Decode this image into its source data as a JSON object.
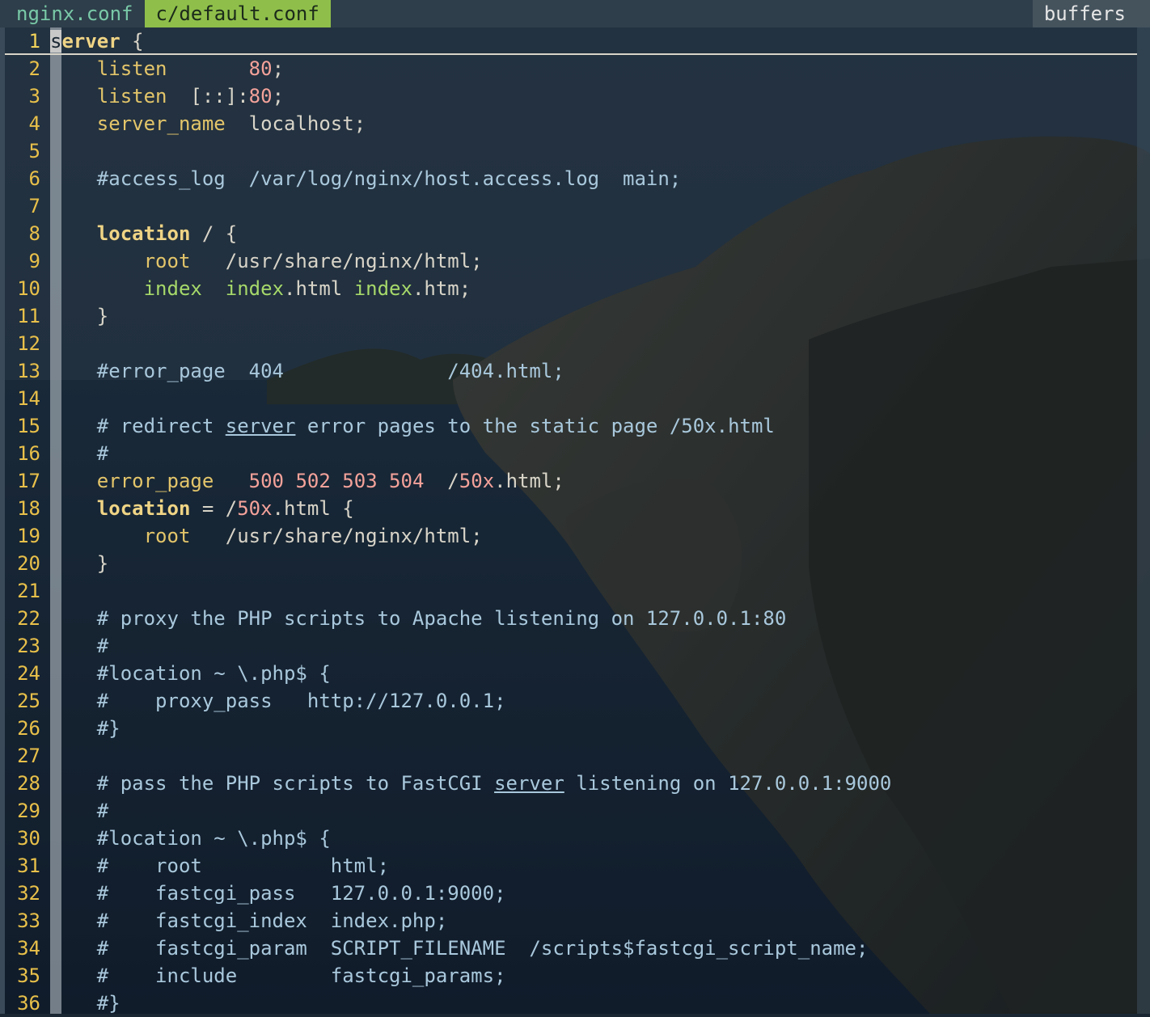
{
  "tabs": [
    {
      "label": "nginx.conf",
      "active": false
    },
    {
      "label": "c/default.conf",
      "active": true
    }
  ],
  "buffers_label": "buffers",
  "editor": {
    "cursor_line": 1,
    "lines": [
      {
        "n": "1",
        "segs": [
          {
            "t": "s",
            "c": "cursor"
          },
          {
            "t": "erver",
            "c": "kwb"
          },
          {
            "t": " {",
            "c": "str"
          }
        ]
      },
      {
        "n": "2",
        "segs": [
          {
            "t": "    ",
            "c": "str"
          },
          {
            "t": "listen",
            "c": "kw"
          },
          {
            "t": "       ",
            "c": "str"
          },
          {
            "t": "80",
            "c": "num"
          },
          {
            "t": ";",
            "c": "str"
          }
        ]
      },
      {
        "n": "3",
        "segs": [
          {
            "t": "    ",
            "c": "str"
          },
          {
            "t": "listen",
            "c": "kw"
          },
          {
            "t": "  [::]:",
            "c": "str"
          },
          {
            "t": "80",
            "c": "num"
          },
          {
            "t": ";",
            "c": "str"
          }
        ]
      },
      {
        "n": "4",
        "segs": [
          {
            "t": "    ",
            "c": "str"
          },
          {
            "t": "server_name",
            "c": "kw"
          },
          {
            "t": "  localhost;",
            "c": "str"
          }
        ]
      },
      {
        "n": "5",
        "segs": []
      },
      {
        "n": "6",
        "segs": [
          {
            "t": "    #access_log  /var/log/nginx/host.access.log  main;",
            "c": "cmt"
          }
        ]
      },
      {
        "n": "7",
        "segs": []
      },
      {
        "n": "8",
        "segs": [
          {
            "t": "    ",
            "c": "str"
          },
          {
            "t": "location",
            "c": "kwb"
          },
          {
            "t": " / {",
            "c": "str"
          }
        ]
      },
      {
        "n": "9",
        "segs": [
          {
            "t": "        ",
            "c": "str"
          },
          {
            "t": "root",
            "c": "kw"
          },
          {
            "t": "   /usr/share/nginx/html;",
            "c": "str"
          }
        ]
      },
      {
        "n": "10",
        "segs": [
          {
            "t": "        ",
            "c": "str"
          },
          {
            "t": "index",
            "c": "grn"
          },
          {
            "t": "  ",
            "c": "str"
          },
          {
            "t": "index",
            "c": "grn"
          },
          {
            "t": ".html ",
            "c": "str"
          },
          {
            "t": "index",
            "c": "grn"
          },
          {
            "t": ".htm;",
            "c": "str"
          }
        ]
      },
      {
        "n": "11",
        "segs": [
          {
            "t": "    }",
            "c": "str"
          }
        ]
      },
      {
        "n": "12",
        "segs": []
      },
      {
        "n": "13",
        "segs": [
          {
            "t": "    #error_page  404              /404.html;",
            "c": "cmt"
          }
        ]
      },
      {
        "n": "14",
        "segs": []
      },
      {
        "n": "15",
        "segs": [
          {
            "t": "    # redirect ",
            "c": "cmt"
          },
          {
            "t": "server",
            "c": "cmt ul"
          },
          {
            "t": " error pages to the static page /50x.html",
            "c": "cmt"
          }
        ]
      },
      {
        "n": "16",
        "segs": [
          {
            "t": "    #",
            "c": "cmt"
          }
        ]
      },
      {
        "n": "17",
        "segs": [
          {
            "t": "    ",
            "c": "str"
          },
          {
            "t": "error_page",
            "c": "kw"
          },
          {
            "t": "   ",
            "c": "str"
          },
          {
            "t": "500 502 503 504",
            "c": "num"
          },
          {
            "t": "  /",
            "c": "str"
          },
          {
            "t": "50x",
            "c": "num"
          },
          {
            "t": ".html;",
            "c": "str"
          }
        ]
      },
      {
        "n": "18",
        "segs": [
          {
            "t": "    ",
            "c": "str"
          },
          {
            "t": "location",
            "c": "kwb"
          },
          {
            "t": " = /",
            "c": "str"
          },
          {
            "t": "50x",
            "c": "num"
          },
          {
            "t": ".html {",
            "c": "str"
          }
        ]
      },
      {
        "n": "19",
        "segs": [
          {
            "t": "        ",
            "c": "str"
          },
          {
            "t": "root",
            "c": "kw"
          },
          {
            "t": "   /usr/share/nginx/html;",
            "c": "str"
          }
        ]
      },
      {
        "n": "20",
        "segs": [
          {
            "t": "    }",
            "c": "str"
          }
        ]
      },
      {
        "n": "21",
        "segs": []
      },
      {
        "n": "22",
        "segs": [
          {
            "t": "    # proxy the PHP scripts to Apache listening on 127.0.0.1:80",
            "c": "cmt"
          }
        ]
      },
      {
        "n": "23",
        "segs": [
          {
            "t": "    #",
            "c": "cmt"
          }
        ]
      },
      {
        "n": "24",
        "segs": [
          {
            "t": "    #location ~ \\.php$ {",
            "c": "cmt"
          }
        ]
      },
      {
        "n": "25",
        "segs": [
          {
            "t": "    #    proxy_pass   http://127.0.0.1;",
            "c": "cmt"
          }
        ]
      },
      {
        "n": "26",
        "segs": [
          {
            "t": "    #}",
            "c": "cmt"
          }
        ]
      },
      {
        "n": "27",
        "segs": []
      },
      {
        "n": "28",
        "segs": [
          {
            "t": "    # pass the PHP scripts to FastCGI ",
            "c": "cmt"
          },
          {
            "t": "server",
            "c": "cmt ul"
          },
          {
            "t": " listening on 127.0.0.1:9000",
            "c": "cmt"
          }
        ]
      },
      {
        "n": "29",
        "segs": [
          {
            "t": "    #",
            "c": "cmt"
          }
        ]
      },
      {
        "n": "30",
        "segs": [
          {
            "t": "    #location ~ \\.php$ {",
            "c": "cmt"
          }
        ]
      },
      {
        "n": "31",
        "segs": [
          {
            "t": "    #    root           html;",
            "c": "cmt"
          }
        ]
      },
      {
        "n": "32",
        "segs": [
          {
            "t": "    #    fastcgi_pass   127.0.0.1:9000;",
            "c": "cmt"
          }
        ]
      },
      {
        "n": "33",
        "segs": [
          {
            "t": "    #    fastcgi_index  index.php;",
            "c": "cmt"
          }
        ]
      },
      {
        "n": "34",
        "segs": [
          {
            "t": "    #    fastcgi_param  SCRIPT_FILENAME  /scripts$fastcgi_script_name;",
            "c": "cmt"
          }
        ]
      },
      {
        "n": "35",
        "segs": [
          {
            "t": "    #    include        fastcgi_params;",
            "c": "cmt"
          }
        ]
      },
      {
        "n": "36",
        "segs": [
          {
            "t": "    #}",
            "c": "cmt"
          }
        ]
      }
    ]
  }
}
